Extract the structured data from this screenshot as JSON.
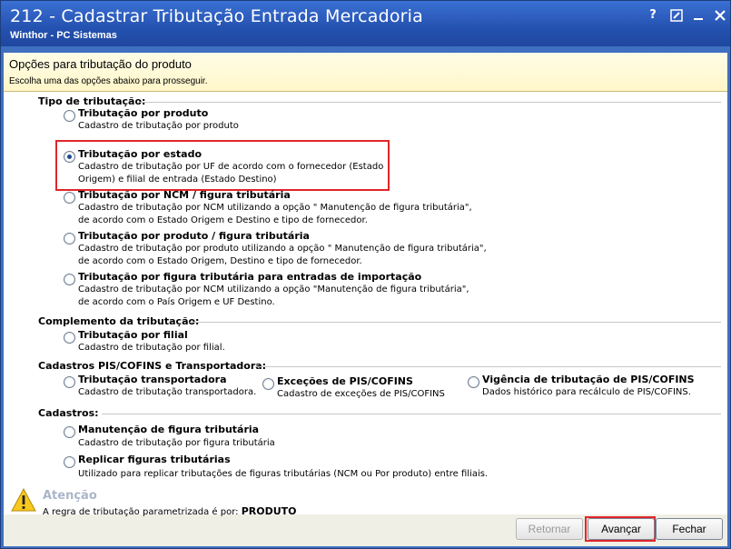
{
  "window": {
    "title": "212 - Cadastrar Tributação Entrada Mercadoria",
    "subtitle": "Winthor - PC Sistemas",
    "controls": {
      "help": "?",
      "edit": "✎",
      "minimize": "─",
      "close": "✕"
    }
  },
  "header": {
    "title": "Opções para tributação do produto",
    "subtitle": "Escolha uma das opções abaixo para prosseguir."
  },
  "groups": {
    "tipo": {
      "title": "Tipo de tributação:",
      "options": [
        {
          "label": "Tributação por produto",
          "desc": [
            "Cadastro de tributação por produto"
          ],
          "checked": false
        },
        {
          "label": "Tributação por estado",
          "desc": [
            "Cadastro de tributação por UF de acordo com o fornecedor (Estado",
            "Origem) e filial de entrada (Estado Destino)"
          ],
          "checked": true
        },
        {
          "label": "Tributação por NCM / figura tributária",
          "desc": [
            "Cadastro de tributação por NCM utilizando a opção \" Manutenção de figura tributária\",",
            "de acordo com o Estado Origem e Destino e tipo de fornecedor."
          ],
          "checked": false
        },
        {
          "label": "Tributação por produto / figura tributária",
          "desc": [
            "Cadastro de tributação por produto utilizando a opção \" Manutenção de figura tributária\",",
            "de acordo com o Estado Origem, Destino e tipo de fornecedor."
          ],
          "checked": false
        },
        {
          "label": "Tributação por figura tributária para entradas de importação",
          "desc": [
            "Cadastro de tributação por NCM utilizando a opção \"Manutenção de figura tributária\",",
            "de acordo com o País Origem e UF Destino."
          ],
          "checked": false
        }
      ]
    },
    "complemento": {
      "title": "Complemento da tributação:",
      "options": [
        {
          "label": "Tributação por filial",
          "desc": [
            "Cadastro de tributação por filial."
          ],
          "checked": false
        }
      ]
    },
    "pis": {
      "title": "Cadastros PIS/COFINS e Transportadora:",
      "options": [
        {
          "label": "Tributação  transportadora",
          "desc": [
            "Cadastro de tributação transportadora."
          ],
          "checked": false
        },
        {
          "label": "Exceções de PIS/COFINS",
          "desc": [
            "Cadastro de exceções de PIS/COFINS"
          ],
          "checked": false
        },
        {
          "label": "Vigência de tributação de PIS/COFINS",
          "desc": [
            "Dados histórico para recálculo de PIS/COFINS."
          ],
          "checked": false
        }
      ]
    },
    "cadastros": {
      "title": "Cadastros:",
      "options": [
        {
          "label": "Manutenção de figura tributária",
          "desc": [
            "Cadastro de tributação por figura tributária"
          ],
          "checked": false
        },
        {
          "label": "Replicar figuras tributárias",
          "desc": [
            "Utilizado para replicar tributações de figuras tributárias (NCM ou Por produto) entre filiais."
          ],
          "checked": false
        }
      ]
    }
  },
  "warning": {
    "title": "Atenção",
    "text": "A regra de tributação parametrizada é por:",
    "value": "PRODUTO"
  },
  "buttons": {
    "back": "Retornar",
    "next": "Avançar",
    "close": "Fechar"
  },
  "colors": {
    "titlebar": "#2452b0",
    "header_bg": "#fff6c8",
    "highlight": "#e0262b"
  }
}
